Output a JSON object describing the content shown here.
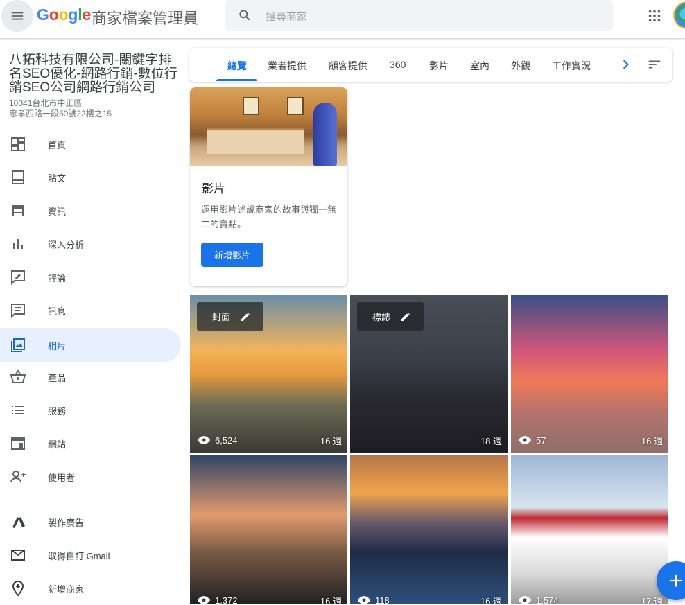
{
  "header": {
    "logo": {
      "g": "G",
      "o1": "o",
      "o2": "o",
      "g2": "g",
      "l": "l",
      "e": "e"
    },
    "product": "商家檔案管理員",
    "search_placeholder": "搜尋商家"
  },
  "business": {
    "name": "八拓科技有限公司-關鍵字排名SEO優化-網路行銷-數位行銷SEO公司網路行銷公司",
    "name_lines": [
      "八拓科技有限公司-關鍵字排",
      "名SEO優化-網路行銷-數位行",
      "銷SEO公司網路行銷公司"
    ],
    "address_line1": "10041台北市中正區",
    "address_line2": "忠孝西路一段50號22樓之15"
  },
  "nav": [
    {
      "label": "首頁",
      "icon": "dashboard-icon"
    },
    {
      "label": "貼文",
      "icon": "posts-icon"
    },
    {
      "label": "資訊",
      "icon": "store-icon"
    },
    {
      "label": "深入分析",
      "icon": "insights-icon"
    },
    {
      "label": "評論",
      "icon": "reviews-icon"
    },
    {
      "label": "訊息",
      "icon": "messages-icon"
    },
    {
      "label": "相片",
      "icon": "photos-icon",
      "active": true
    },
    {
      "label": "產品",
      "icon": "products-icon"
    },
    {
      "label": "服務",
      "icon": "services-icon"
    },
    {
      "label": "網站",
      "icon": "website-icon"
    },
    {
      "label": "使用者",
      "icon": "add-user-icon"
    }
  ],
  "nav_bottom": [
    {
      "label": "製作廣告",
      "icon": "ads-icon"
    },
    {
      "label": "取得自訂 Gmail",
      "icon": "gmail-icon"
    },
    {
      "label": "新增商家",
      "icon": "add-location-icon"
    }
  ],
  "tabs": [
    "總覽",
    "業者提供",
    "顧客提供",
    "360",
    "影片",
    "室內",
    "外觀",
    "工作實況"
  ],
  "active_tab": "總覽",
  "video_card": {
    "title": "影片",
    "description": "運用影片述說商家的故事與獨一無二的賣點。",
    "button": "新增影片"
  },
  "photos": [
    {
      "label": "封面",
      "views": "6,524",
      "age": "16 週"
    },
    {
      "label": "標誌",
      "views": "",
      "age": "18 週"
    },
    {
      "label": "",
      "views": "57",
      "age": "16 週"
    },
    {
      "label": "",
      "views": "1,372",
      "age": "16 週"
    },
    {
      "label": "",
      "views": "118",
      "age": "16 週"
    },
    {
      "label": "",
      "views": "1,574",
      "age": "17 週"
    }
  ],
  "colors": {
    "accent": "#1a73e8",
    "active_nav_bg": "#e8f0fe"
  }
}
